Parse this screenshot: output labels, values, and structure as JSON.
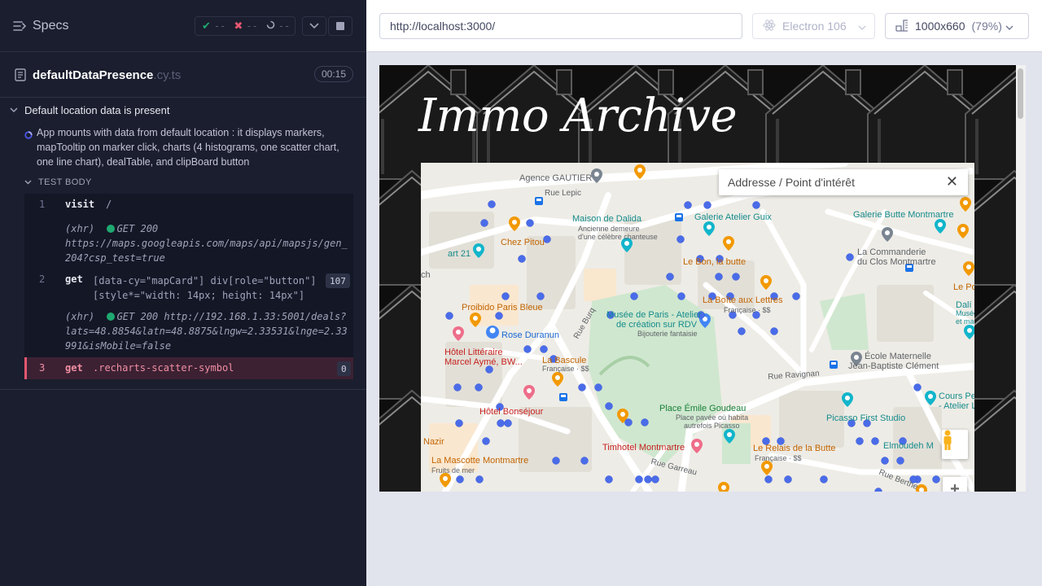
{
  "runner": {
    "specs_label": "Specs",
    "stats": {
      "passed": "--",
      "failed": "--",
      "pending": "--"
    },
    "file": {
      "name": "defaultDataPresence",
      "ext": ".cy.ts",
      "duration": "00:15"
    },
    "suite_title": "Default location data is present",
    "test_title": "App mounts with data from default location : it displays markers, mapTooltip on marker click, charts (4 histograms, one scatter chart, one line chart), dealTable, and clipBoard button",
    "test_body_label": "TEST BODY",
    "commands": [
      {
        "num": "1",
        "name": "visit",
        "message": "/"
      },
      {
        "xhr_label": "(xhr)",
        "xhr_line1": "GET 200",
        "xhr_line2": "https://maps.googleapis.com/maps/api/mapsjs/gen_",
        "xhr_line3": "204?csp_test=true"
      },
      {
        "num": "2",
        "name": "get",
        "message_line1": "[data-cy=\"mapCard\"] div[role=\"button\"]",
        "message_line2": "[style*=\"width: 14px; height: 14px\"]",
        "count": "107"
      },
      {
        "xhr_label": "(xhr)",
        "xhr_line1": "GET 200 http://192.168.1.33:5001/deals?",
        "xhr_line2": "lats=48.8854&latn=48.8875&lngw=2.33531&lnge=2.33",
        "xhr_line3": "991&isMobile=false"
      },
      {
        "num": "3",
        "name": "get",
        "message": ".recharts-scatter-symbol",
        "count": "0"
      }
    ]
  },
  "aut": {
    "url": "http://localhost:3000/",
    "browser": "Electron 106",
    "viewport": "1000x660",
    "viewport_pct": "(79%)",
    "app_title": "Immo Archive",
    "search_placeholder": "Addresse / Point d'intérêt",
    "map_labels": {
      "agence_gautier": "Agence GAUTIER",
      "rue_lepic": "Rue Lepic",
      "maison_dalida": "Maison de Dalida",
      "maison_dalida_sub1": "Ancienne demeure",
      "maison_dalida_sub2": "d'une célèbre chanteuse",
      "galerie_guix": "Galerie Atelier Guix",
      "galerie_butte": "Galerie Butte Montmartre",
      "chez_pitou": "Chez Pitou",
      "art21": "art 21",
      "le_bon": "Le Bon, la butte",
      "commanderie1": "La Commanderie",
      "commanderie2": "du Clos Montmartre",
      "le_po": "Le Po",
      "ch": "ch",
      "dali": "Dalí",
      "dali_sub1": "Musée",
      "dali_sub2": "et ma",
      "proibido": "Proibido Paris Bleue",
      "rose_duranun": "Rose Duranun",
      "hotel_litteraire1": "Hôtel Littéraire",
      "hotel_litteraire2": "Marcel Aymé, BW...",
      "musee_paris1": "Musée de Paris - Atelier",
      "musee_paris2": "de création sur RDV",
      "musee_paris_sub": "Bijouterie fantaisie",
      "boite_lettres": "La Boîte aux Lettres",
      "boite_lettres_sub": "Française · $$",
      "la_bascule": "La Bascule",
      "la_bascule_sub": "Française · $$",
      "rue_burq": "Rue Burq",
      "ecole1": "École Maternelle",
      "ecole2": "Jean-Baptiste Clément",
      "rue_ravignan": "Rue Ravignan",
      "hotel_bonsejour": "Hôtel Bonséjour",
      "place_goudeau": "Place Émile Goudeau",
      "place_goudeau_sub1": "Place pavée où habita",
      "place_goudeau_sub2": "autrefois Picasso",
      "picasso_studio": "Picasso First Studio",
      "cours_pe1": "Cours Pe",
      "cours_pe2": "- Atelier Li",
      "nazir": "Nazir",
      "timhotel": "Timhotel Montmartre",
      "relais_butte": "Le Relais de la Butte",
      "relais_butte_sub": "Française · $$",
      "elmoudeh": "Elmoudeh M",
      "la_mascotte": "La Mascotte Montmartre",
      "la_mascotte_sub": "Fruits de mer",
      "rue_garreau": "Rue Garreau",
      "rue_berthe": "Rue Berthe"
    }
  }
}
